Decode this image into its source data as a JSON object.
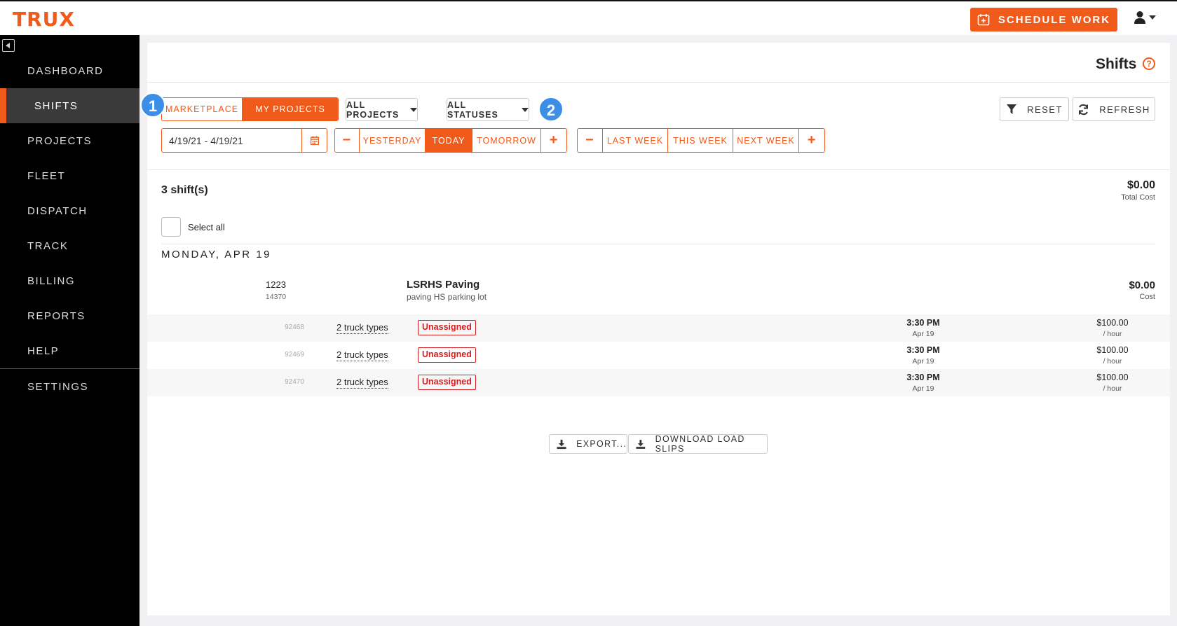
{
  "app": {
    "logo_text": "TRUX"
  },
  "header": {
    "schedule_label": "SCHEDULE WORK",
    "user_icon": "user-icon"
  },
  "sidebar": {
    "items": [
      {
        "label": "DASHBOARD"
      },
      {
        "label": "SHIFTS"
      },
      {
        "label": "PROJECTS"
      },
      {
        "label": "FLEET"
      },
      {
        "label": "DISPATCH"
      },
      {
        "label": "TRACK"
      },
      {
        "label": "BILLING"
      },
      {
        "label": "REPORTS"
      },
      {
        "label": "HELP"
      },
      {
        "label": "SETTINGS"
      }
    ],
    "active": "SHIFTS"
  },
  "page": {
    "title": "Shifts",
    "help_glyph": "?"
  },
  "annotations": [
    "1",
    "2"
  ],
  "filters": {
    "source_toggle": {
      "marketplace": "MARKETPLACE",
      "my_projects": "MY PROJECTS",
      "selected": "MY PROJECTS"
    },
    "projects_dropdown": "ALL PROJECTS",
    "statuses_dropdown": "ALL STATUSES",
    "reset_label": "RESET",
    "refresh_label": "REFRESH",
    "date_range": "4/19/21  -  4/19/21",
    "day_nav": {
      "minus": "−",
      "yesterday": "YESTERDAY",
      "today": "TODAY",
      "tomorrow": "TOMORROW",
      "plus": "+",
      "selected": "TODAY"
    },
    "week_nav": {
      "minus": "−",
      "last_week": "LAST WEEK",
      "this_week": "THIS WEEK",
      "next_week": "NEXT WEEK",
      "plus": "+"
    }
  },
  "summary": {
    "count": "3 shift(s)",
    "total_cost": "$0.00",
    "total_cost_label": "Total Cost",
    "select_all": "Select all"
  },
  "day_group": {
    "header": "MONDAY, APR 19",
    "project": {
      "id": "1223",
      "sub_id": "14370",
      "name": "LSRHS Paving",
      "description": "paving HS parking lot",
      "cost": "$0.00",
      "cost_label": "Cost"
    },
    "shifts": [
      {
        "id": "92468",
        "trucks": "2 truck types",
        "status": "Unassigned",
        "time": "3:30 PM",
        "date": "Apr 19",
        "rate": "$100.00",
        "rate_unit": "/ hour"
      },
      {
        "id": "92469",
        "trucks": "2 truck types",
        "status": "Unassigned",
        "time": "3:30 PM",
        "date": "Apr 19",
        "rate": "$100.00",
        "rate_unit": "/ hour"
      },
      {
        "id": "92470",
        "trucks": "2 truck types",
        "status": "Unassigned",
        "time": "3:30 PM",
        "date": "Apr 19",
        "rate": "$100.00",
        "rate_unit": "/ hour"
      }
    ]
  },
  "footer_actions": {
    "export": "EXPORT...",
    "download_load_slips": "DOWNLOAD LOAD SLIPS"
  },
  "colors": {
    "accent": "#f05a1a",
    "status_red": "#d42020",
    "annotation_blue": "#3d8ee6"
  }
}
